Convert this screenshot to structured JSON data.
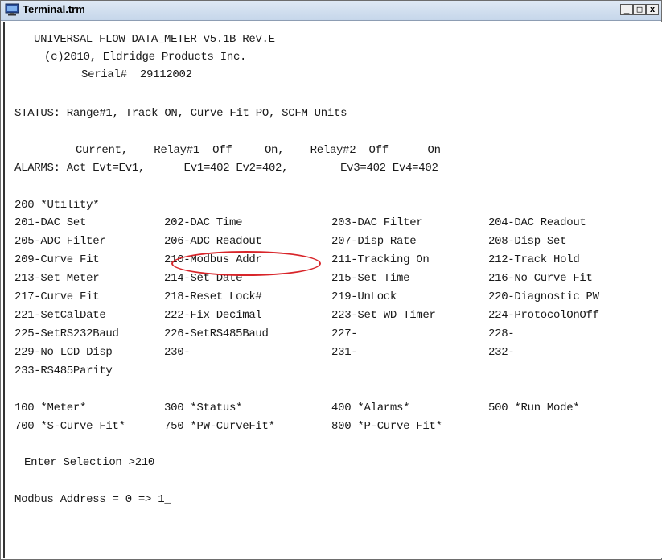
{
  "window": {
    "title": "Terminal.trm",
    "controls": {
      "min": "_",
      "max": "□",
      "close": "x"
    }
  },
  "header": {
    "line1": "UNIVERSAL FLOW DATA_METER v5.1B Rev.E",
    "line2": "(c)2010, Eldridge Products Inc.",
    "line3": "Serial#  29112002"
  },
  "status": "STATUS: Range#1, Track ON, Curve Fit PO, SCFM Units",
  "alarms": {
    "line1": "Current,    Relay#1  Off     On,    Relay#2  Off      On",
    "line2": "ALARMS: Act Evt=Ev1,      Ev1=402 Ev2=402,        Ev3=402 Ev4=402"
  },
  "utility_title": "200 *Utility*",
  "menu_rows": [
    [
      "201-DAC Set",
      "202-DAC Time",
      "203-DAC Filter",
      "204-DAC Readout"
    ],
    [
      "205-ADC Filter",
      "206-ADC Readout",
      "207-Disp Rate",
      "208-Disp Set"
    ],
    [
      "209-Curve Fit",
      "210-Modbus Addr",
      "211-Tracking On",
      "212-Track Hold"
    ],
    [
      "213-Set Meter",
      "214-Set Date",
      "215-Set Time",
      "216-No Curve Fit"
    ],
    [
      "217-Curve Fit",
      "218-Reset Lock#",
      "219-UnLock",
      "220-Diagnostic PW"
    ],
    [
      "221-SetCalDate",
      "222-Fix Decimal",
      "223-Set WD Timer",
      "224-ProtocolOnOff"
    ],
    [
      "225-SetRS232Baud",
      "226-SetRS485Baud",
      "227-",
      "228-"
    ],
    [
      "229-No LCD Disp",
      "230-",
      "231-",
      "232-"
    ],
    [
      "233-RS485Parity",
      "",
      "",
      ""
    ]
  ],
  "main_menu_rows": [
    [
      "100 *Meter*",
      "300 *Status*",
      "400 *Alarms*",
      "500 *Run Mode*"
    ],
    [
      "700 *S-Curve Fit*",
      "750 *PW-CurveFit*",
      "800 *P-Curve Fit*",
      ""
    ]
  ],
  "prompt": "Enter Selection >210",
  "result": {
    "text": "Modbus Address = 0 => 1",
    "cursor": "_"
  },
  "colors": {
    "highlight": "#d8252a",
    "text": "#1a1a1a"
  }
}
